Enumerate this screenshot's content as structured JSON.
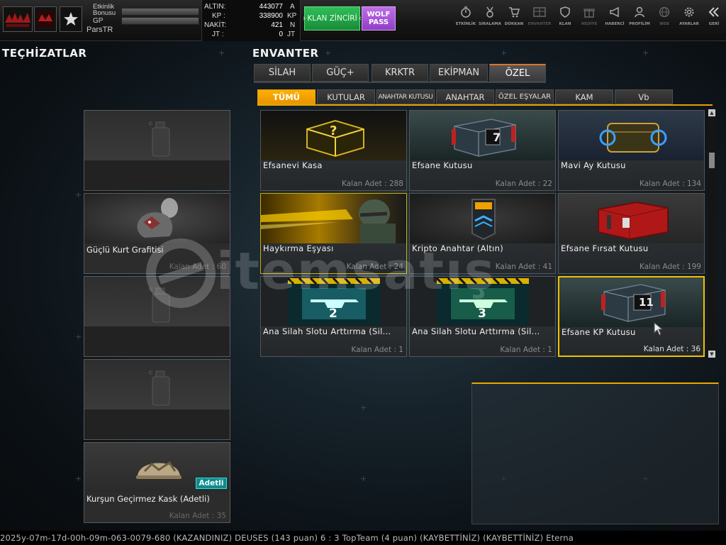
{
  "header": {
    "labels": {
      "bonus": "Etkinlik Bonusu",
      "gp": "GP",
      "user": "ParsTR"
    },
    "currencies": [
      {
        "name": "ALTIN:",
        "value": "443077",
        "unit": "A"
      },
      {
        "name": "KP :",
        "value": "338900",
        "unit": "KP"
      },
      {
        "name": "NAKİT:",
        "value": "421",
        "unit": "N"
      },
      {
        "name": "JT :",
        "value": "0",
        "unit": "JT"
      }
    ],
    "clan_chain": "KLAN ZİNCİRİ",
    "wolf_pass": "WOLF PASS",
    "nav": [
      {
        "label": "ETKİNLİK",
        "icon": "stopwatch-icon"
      },
      {
        "label": "SIRALAMA",
        "icon": "medal-icon"
      },
      {
        "label": "DÜKKAN",
        "icon": "cart-icon"
      },
      {
        "label": "ENVANTER",
        "icon": "inventory-icon"
      },
      {
        "label": "KLAN",
        "icon": "shield-icon"
      },
      {
        "label": "HEDİYE",
        "icon": "gift-icon"
      },
      {
        "label": "HABERCİ",
        "icon": "megaphone-icon"
      },
      {
        "label": "PROFİLİM",
        "icon": "profile-icon"
      },
      {
        "label": "WEB",
        "icon": "globe-icon"
      },
      {
        "label": "AYARLAR",
        "icon": "gear-icon"
      },
      {
        "label": "GERİ",
        "icon": "back-chevrons-icon"
      }
    ]
  },
  "left": {
    "title": "TEÇHİZATLAR",
    "slots": [
      {
        "name": "",
        "count": ""
      },
      {
        "name": "Güçlü Kurt Grafitisi",
        "count": "Kalan Adet : 60"
      },
      {
        "name": "",
        "count": ""
      },
      {
        "name": "",
        "count": ""
      },
      {
        "name": "Kurşun Geçirmez Kask (Adetli)",
        "count": "Kalan Adet : 35",
        "badge": "Adetli"
      }
    ]
  },
  "inventory": {
    "title": "ENVANTER",
    "tabs": [
      "SİLAH",
      "GÜÇ+",
      "KRKTR",
      "EKİPMAN",
      "ÖZEL"
    ],
    "active_tab": "ÖZEL",
    "subtabs": [
      "TÜMÜ",
      "KUTULAR",
      "ANAHTAR KUTUSU",
      "ANAHTAR",
      "ÖZEL EŞYALAR",
      "KAM",
      "Vb"
    ],
    "active_subtab": "TÜMÜ",
    "items": [
      {
        "name": "Efsanevi Kasa",
        "count": "Kalan Adet : 288",
        "number": ""
      },
      {
        "name": "Efsane Kutusu",
        "count": "Kalan Adet : 22",
        "number": "7"
      },
      {
        "name": "Mavi Ay Kutusu",
        "count": "Kalan Adet : 134",
        "number": ""
      },
      {
        "name": "Haykırma Eşyası",
        "count": "Kalan Adet : 24",
        "number": ""
      },
      {
        "name": "Kripto Anahtar (Altın)",
        "count": "Kalan Adet : 41",
        "number": ""
      },
      {
        "name": "Efsane Fırsat Kutusu",
        "count": "Kalan Adet : 199",
        "number": ""
      },
      {
        "name": "Ana Silah Slotu Arttırma (Sil...",
        "count": "Kalan Adet : 1",
        "number": "2"
      },
      {
        "name": "Ana Silah Slotu Arttırma (Sil...",
        "count": "Kalan Adet : 1",
        "number": "3"
      },
      {
        "name": "Efsane KP Kutusu",
        "count": "Kalan Adet : 36",
        "number": "11"
      }
    ]
  },
  "watermark": "itemsatış",
  "ticker": "2025y-07m-17d-00h-09m-063-0079-680        (KAZANDINIZ) DEUSES (143 puan) 6 : 3 TopTeam (4 puan) (KAYBETTİNİZ)        (KAYBETTİNİZ) Eterna"
}
